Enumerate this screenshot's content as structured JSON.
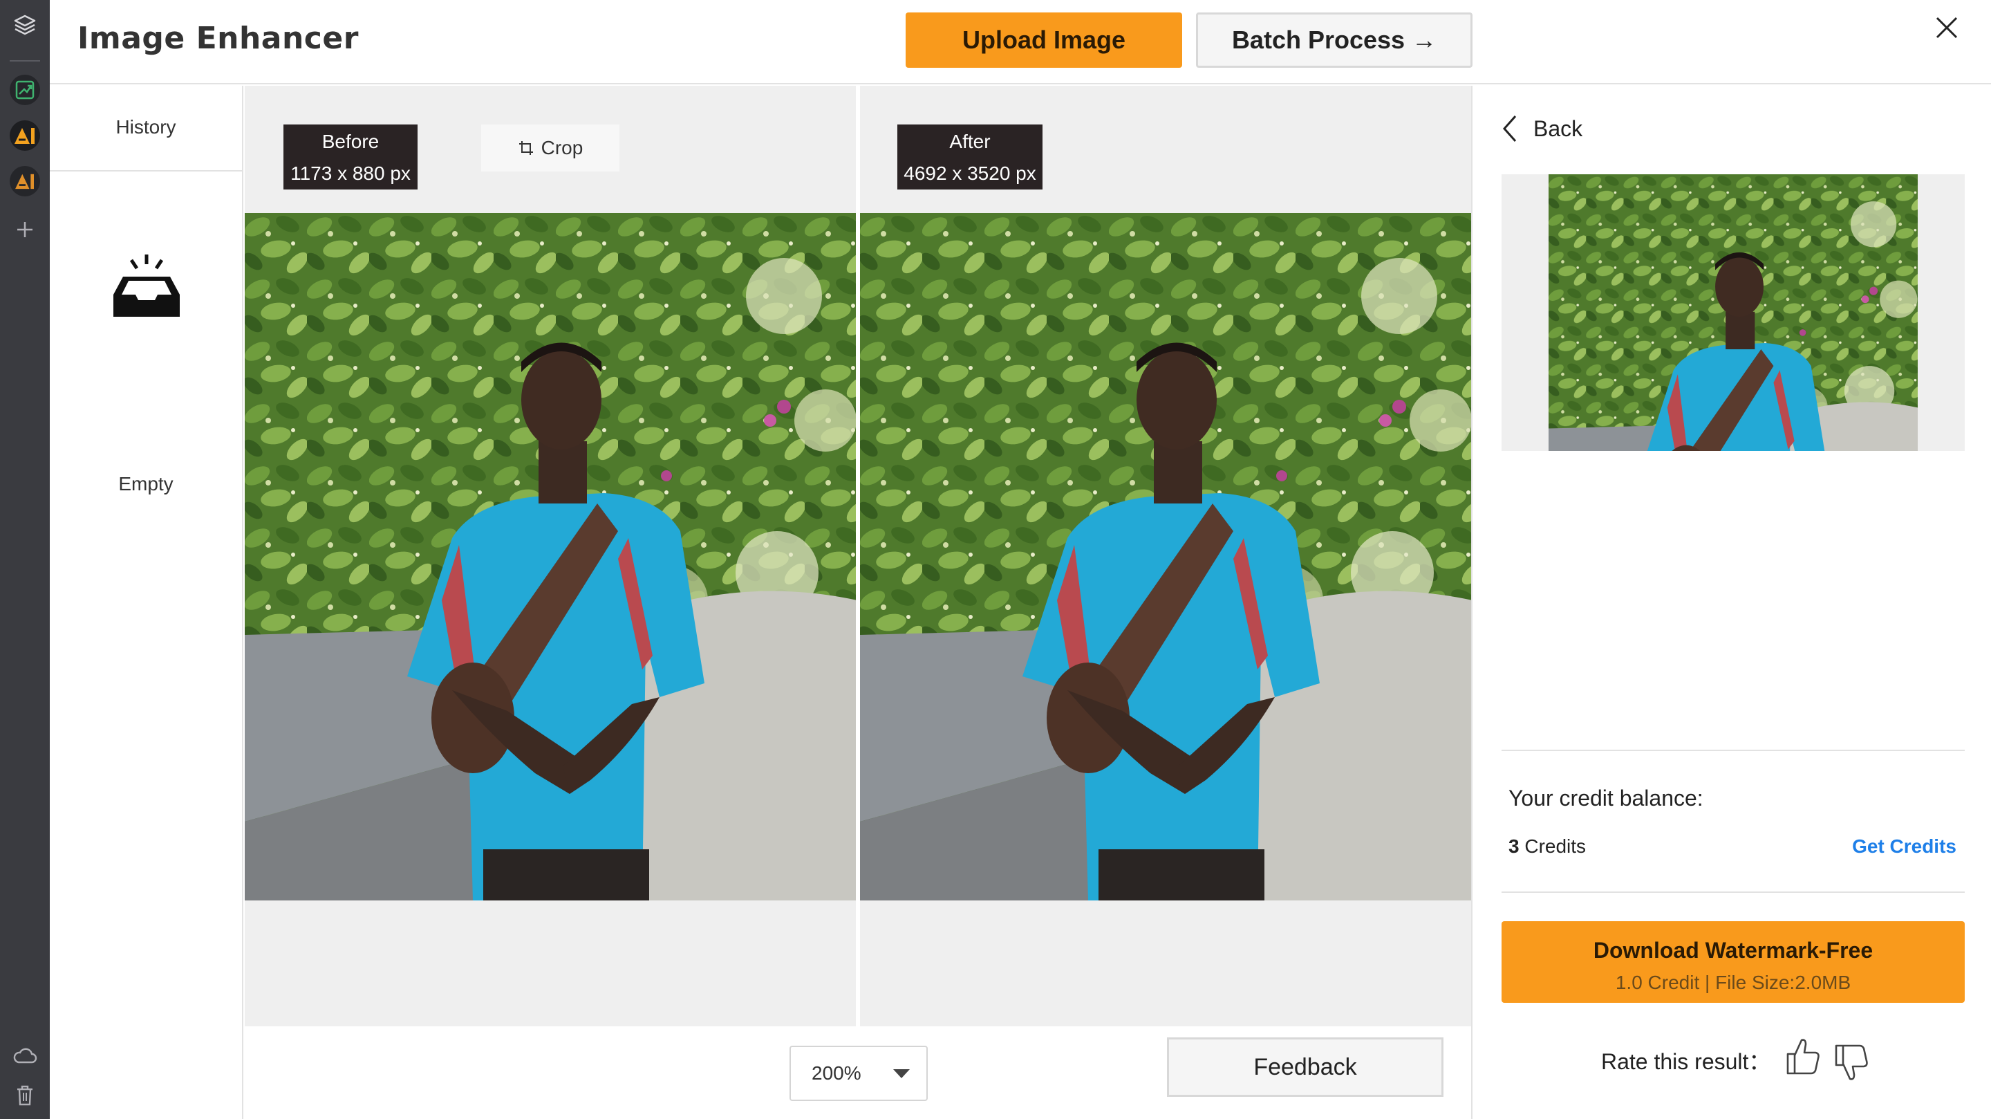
{
  "app": {
    "title": "Image Enhancer"
  },
  "header": {
    "upload_label": "Upload Image",
    "batch_label": "Batch Process →"
  },
  "rail": {
    "icons": [
      "layers-icon",
      "enhance-tool-icon",
      "ai-tool-icon",
      "ai-tool-2-icon",
      "add-icon",
      "cloud-icon",
      "trash-icon"
    ]
  },
  "history": {
    "title": "History",
    "empty_label": "Empty"
  },
  "compare": {
    "before": {
      "label": "Before",
      "size": "1173 x 880 px"
    },
    "after": {
      "label": "After",
      "size": "4692 x 3520 px"
    },
    "crop_label": "Crop"
  },
  "bottombar": {
    "zoom_value": "200%",
    "feedback_label": "Feedback"
  },
  "panel": {
    "back_label": "Back",
    "credit_balance_label": "Your credit balance:",
    "credit_count": "3",
    "credit_unit": " Credits",
    "get_credits_label": "Get Credits",
    "download_label": "Download Watermark-Free",
    "download_sub": "1.0 Credit | File Size:2.0MB",
    "rate_label": "Rate this result："
  },
  "colors": {
    "accent": "#f99a1c",
    "link": "#1e7fe8",
    "rail": "#3a3b40",
    "tag": "#2a2324"
  }
}
